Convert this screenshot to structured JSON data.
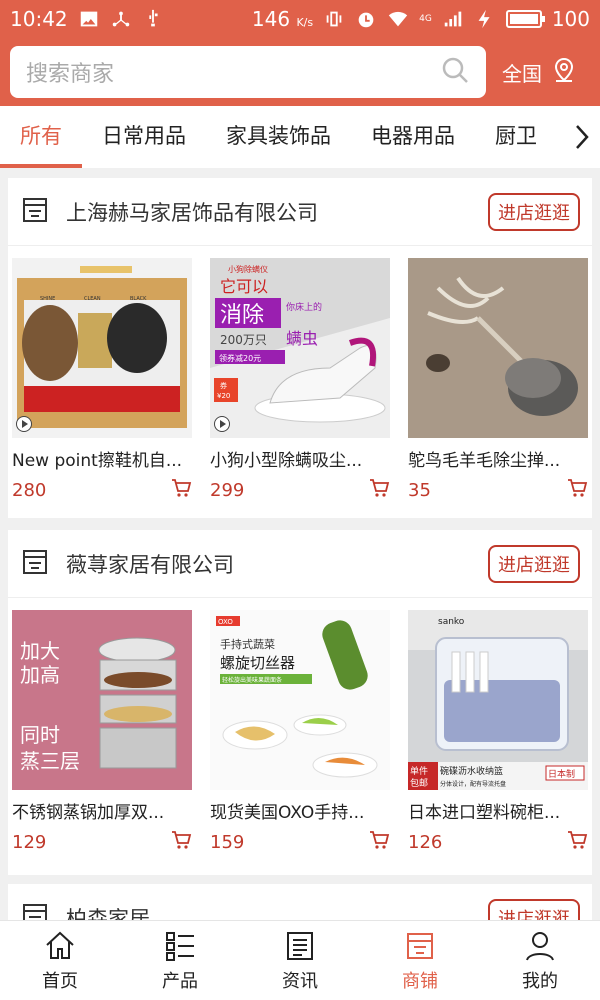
{
  "status_bar": {
    "time": "10:42",
    "speed": "146",
    "speed_unit": "K/s",
    "network": "4G",
    "battery": "100"
  },
  "search": {
    "placeholder": "搜索商家",
    "region_label": "全国"
  },
  "tabs": [
    {
      "label": "所有",
      "active": true
    },
    {
      "label": "日常用品"
    },
    {
      "label": "家具装饰品"
    },
    {
      "label": "电器用品"
    },
    {
      "label": "厨卫"
    }
  ],
  "shops": [
    {
      "name": "上海赫马家居饰品有限公司",
      "visit_label": "进店逛逛",
      "products": [
        {
          "name": "New point擦鞋机自...",
          "price": "280",
          "image_text": [
            "SHINE",
            "CLEAN",
            "BLACK"
          ]
        },
        {
          "name": "小狗小型除螨吸尘...",
          "price": "299",
          "image_text": [
            "小狗除螨仪",
            "它可以",
            "消除",
            "你床上的",
            "200万只",
            "螨虫",
            "领券减20元",
            "券",
            "¥20"
          ]
        },
        {
          "name": "鸵鸟毛羊毛除尘掸...",
          "price": "35"
        }
      ]
    },
    {
      "name": "薇荨家居有限公司",
      "visit_label": "进店逛逛",
      "products": [
        {
          "name": "不锈钢蒸锅加厚双...",
          "price": "129",
          "image_text": [
            "加大",
            "加高",
            "同时",
            "蒸三层"
          ]
        },
        {
          "name": "现货美国OXO手持...",
          "price": "159",
          "image_text": [
            "OXO",
            "手持式蔬菜",
            "螺旋切丝器",
            "轻松旋出美味果蔬面条"
          ]
        },
        {
          "name": "日本进口塑料碗柜...",
          "price": "126",
          "image_text": [
            "sanko",
            "单件",
            "包邮",
            "碗碟沥水收纳篮",
            "分体设计，配有导流托盘",
            "日本制"
          ]
        }
      ]
    },
    {
      "name": "柏森家居",
      "visit_label": "进店逛逛"
    }
  ],
  "bottom_nav": [
    {
      "label": "首页",
      "icon": "home-icon"
    },
    {
      "label": "产品",
      "icon": "list-icon"
    },
    {
      "label": "资讯",
      "icon": "news-icon"
    },
    {
      "label": "商铺",
      "icon": "shop-icon",
      "active": true
    },
    {
      "label": "我的",
      "icon": "user-icon"
    }
  ],
  "colors": {
    "accent": "#e0614a",
    "price": "#c0392b"
  }
}
